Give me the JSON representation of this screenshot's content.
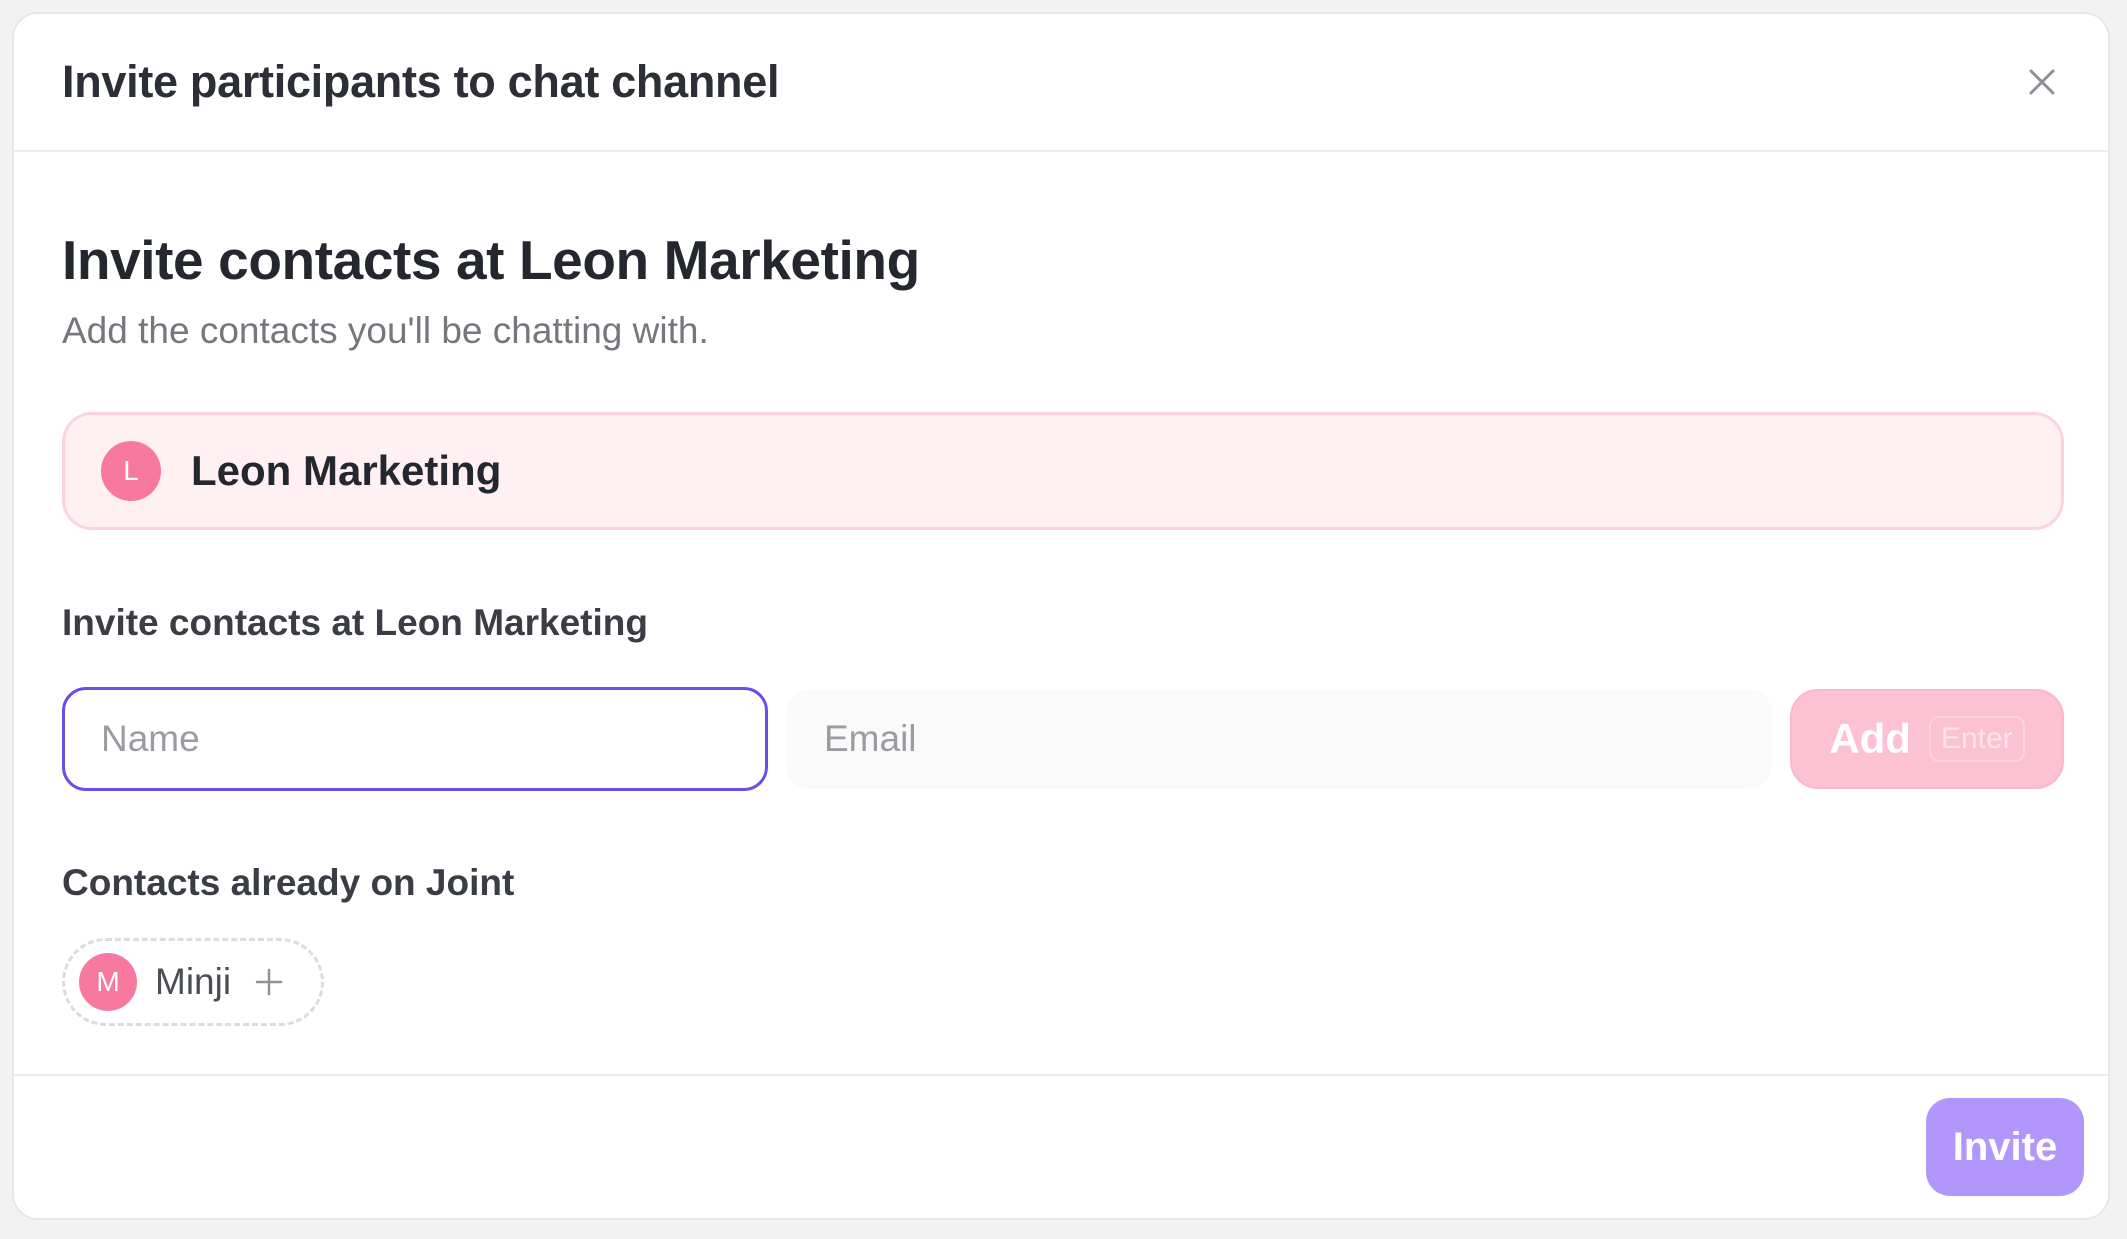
{
  "dialog": {
    "title": "Invite participants to chat channel",
    "close_icon": "close-icon"
  },
  "intro": {
    "title": "Invite contacts at Leon Marketing",
    "subtitle": "Add the contacts you'll be chatting with."
  },
  "company": {
    "initial": "L",
    "name": "Leon Marketing",
    "avatar_color": "#f8799f"
  },
  "invite_form": {
    "label": "Invite contacts at Leon Marketing",
    "name_placeholder": "Name",
    "name_value": "",
    "email_placeholder": "Email",
    "email_value": "",
    "add_label": "Add",
    "add_shortcut": "Enter"
  },
  "existing_contacts": {
    "label": "Contacts already on Joint",
    "items": [
      {
        "initial": "M",
        "name": "Minji",
        "action_icon": "plus-icon"
      }
    ]
  },
  "footer": {
    "invite_label": "Invite",
    "accent_color": "#b197fb"
  }
}
